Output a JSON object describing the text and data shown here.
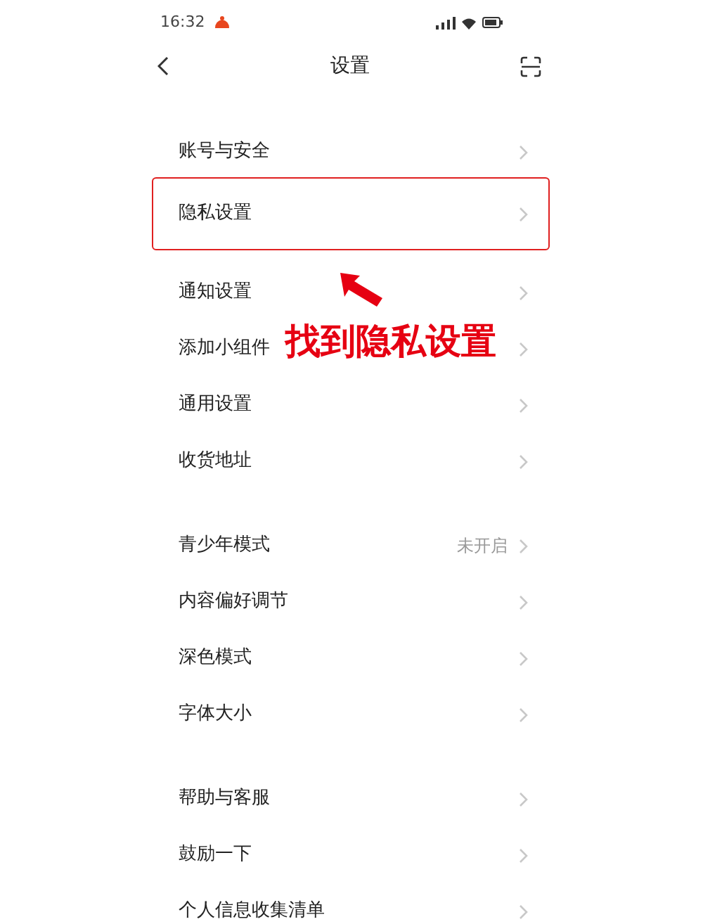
{
  "status_bar": {
    "time": "16:32"
  },
  "header": {
    "title": "设置"
  },
  "groups": [
    {
      "items": [
        {
          "label": "账号与安全",
          "highlighted": false
        },
        {
          "label": "隐私设置",
          "highlighted": true
        },
        {
          "label": "通知设置",
          "highlighted": false
        },
        {
          "label": "添加小组件",
          "highlighted": false
        },
        {
          "label": "通用设置",
          "highlighted": false
        },
        {
          "label": "收货地址",
          "highlighted": false
        }
      ]
    },
    {
      "items": [
        {
          "label": "青少年模式",
          "value": "未开启",
          "highlighted": false
        },
        {
          "label": "内容偏好调节",
          "highlighted": false
        },
        {
          "label": "深色模式",
          "highlighted": false
        },
        {
          "label": "字体大小",
          "highlighted": false
        }
      ]
    },
    {
      "items": [
        {
          "label": "帮助与客服",
          "highlighted": false
        },
        {
          "label": "鼓励一下",
          "highlighted": false
        },
        {
          "label": "个人信息收集清单",
          "highlighted": false
        }
      ]
    }
  ],
  "annotation": {
    "text": "找到隐私设置"
  }
}
